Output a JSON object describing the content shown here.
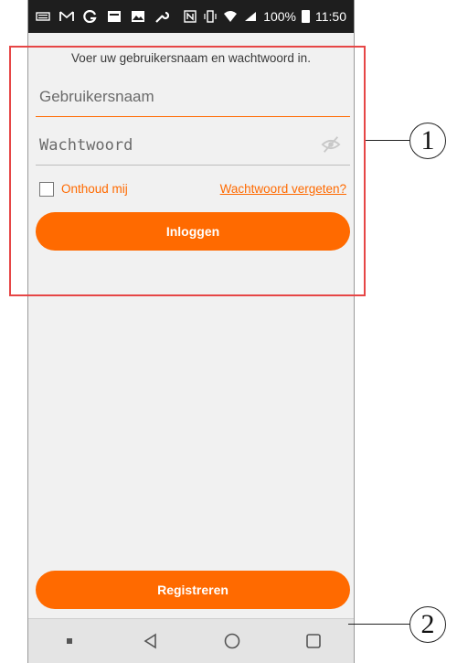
{
  "statusbar": {
    "battery": "100%",
    "time": "11:50",
    "left_icons": [
      "keyboard-icon",
      "gmail-icon",
      "g-icon",
      "gallery-icon",
      "photos-icon",
      "wrench-icon"
    ],
    "right_icons": [
      "nfc-icon",
      "vibrate-icon",
      "wifi-icon",
      "signal-icon"
    ]
  },
  "login": {
    "instruction": "Voer uw gebruikersnaam en wachtwoord in.",
    "username_placeholder": "Gebruikersnaam",
    "password_placeholder": "Wachtwoord",
    "remember_label": "Onthoud mij",
    "forgot_link": "Wachtwoord vergeten?",
    "login_button": "Inloggen"
  },
  "register_button": "Registreren",
  "annotations": {
    "callout_1": "1",
    "callout_2": "2"
  },
  "colors": {
    "accent": "#ff6a00",
    "annotation_box": "#e64646"
  }
}
